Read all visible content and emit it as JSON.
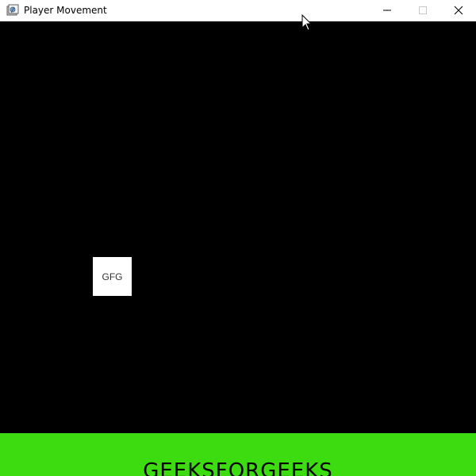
{
  "window": {
    "title": "Player Movement",
    "icon": "app-icon",
    "controls": {
      "minimize_icon": "minimize-icon",
      "maximize_icon": "maximize-icon",
      "close_icon": "close-icon"
    }
  },
  "game": {
    "background_color": "#000000",
    "player": {
      "label": "GFG",
      "color": "#ffffff"
    },
    "ground": {
      "color": "#3ddc10",
      "text": "GEEKSFORGEEKS"
    }
  },
  "pointer": {
    "icon": "mouse-cursor-icon"
  }
}
